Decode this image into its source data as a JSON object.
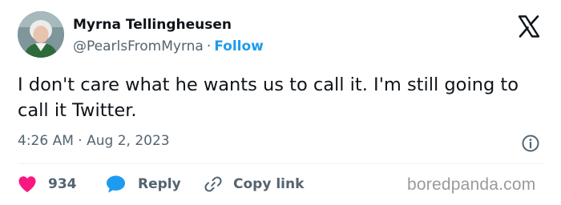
{
  "author": {
    "name": "Myrna Tellingheusen",
    "handle": "@PearlsFromMyrna",
    "separator": "·",
    "follow_label": "Follow",
    "avatar_icon": "profile-photo"
  },
  "platform_icon": "x-logo-icon",
  "tweet": {
    "text": "I don't care what he wants us to call it. I'm still going to call it Twitter.",
    "time": "4:26 AM",
    "separator": "·",
    "date": "Aug 2, 2023"
  },
  "actions": {
    "like_count": "934",
    "reply_label": "Reply",
    "copy_link_label": "Copy link"
  },
  "watermark": "boredpanda.com",
  "colors": {
    "accent": "#1d9bf0",
    "like": "#f91880",
    "text": "#0f1419",
    "muted": "#536471"
  }
}
